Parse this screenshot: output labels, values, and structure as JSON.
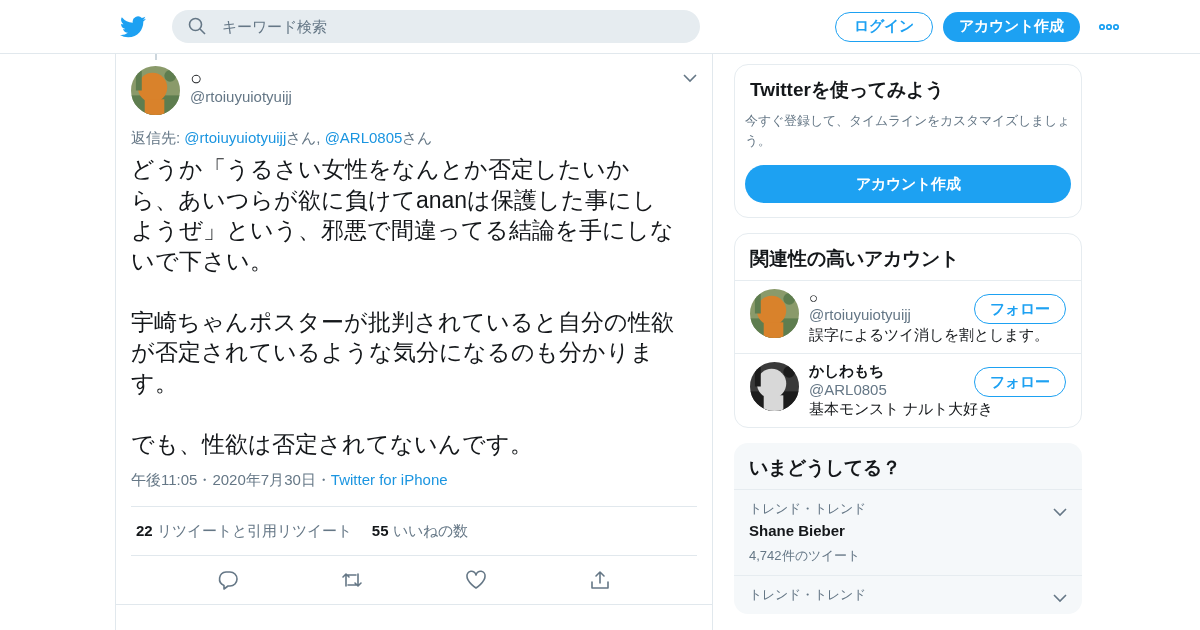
{
  "header": {
    "search": {
      "placeholder": "キーワード検索"
    },
    "login": "ログイン",
    "signup": "アカウント作成"
  },
  "tweet": {
    "name": "○",
    "handle": "@rtoiuyuiotyuijj",
    "reply_to": {
      "label": "返信先: ",
      "accounts": [
        {
          "handle": "@rtoiuyuiotyuijj",
          "suffix": "さん, "
        },
        {
          "handle": "@ARL0805",
          "suffix": "さん"
        }
      ]
    },
    "paragraphs": [
      "どうか「うるさい女性をなんとか否定したいから、あいつらが欲に負けてananは保護した事にしようぜ」という、邪悪で間違ってる結論を手にしないで下さい。",
      "宇崎ちゃんポスターが批判されていると自分の性欲が否定されているような気分になるのも分かります。",
      "でも、性欲は否定されてないんです。"
    ],
    "meta": {
      "time": "午後11:05",
      "separator": "・",
      "date": "2020年7月30日",
      "source": "Twitter for iPhone"
    },
    "stats": [
      {
        "count": "22",
        "label": "リツイートと引用リツイート"
      },
      {
        "count": "55",
        "label": "いいねの数"
      }
    ]
  },
  "signup_card": {
    "title": "Twitterを使ってみよう",
    "text": "今すぐ登録して、タイムラインをカスタマイズしましょう。",
    "button": "アカウント作成"
  },
  "related": {
    "title": "関連性の高いアカウント",
    "accounts": [
      {
        "name": "○",
        "handle": "@rtoiuyuiotyuijj",
        "bio": "誤字によるツイ消しを割とします。",
        "follow": "フォロー"
      },
      {
        "name": "かしわもち",
        "handle": "@ARL0805",
        "bio": "基本モンスト ナルト大好き",
        "follow": "フォロー"
      }
    ]
  },
  "trends": {
    "title": "いまどうしてる？",
    "items": [
      {
        "context": "トレンド・トレンド",
        "name": "Shane Bieber",
        "count": "4,742件のツイート"
      },
      {
        "context": "トレンド・トレンド"
      }
    ]
  }
}
